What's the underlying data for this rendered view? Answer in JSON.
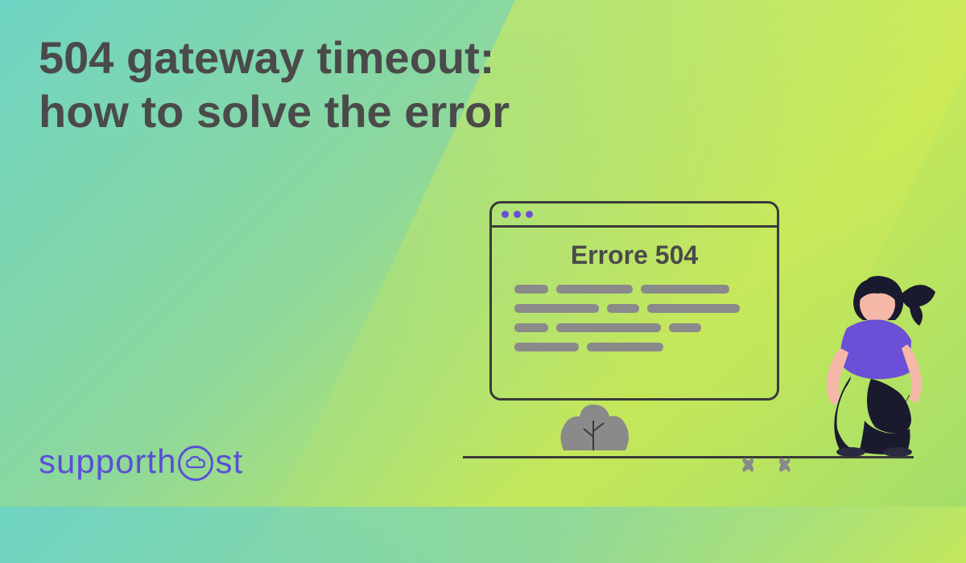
{
  "title_line1": "504 gateway timeout:",
  "title_line2": "how to solve the error",
  "logo": {
    "part1": "supporth",
    "part2": "st"
  },
  "browser": {
    "title": "Errore 504"
  },
  "colors": {
    "text_dark": "#4a4a4a",
    "brand_purple": "#5a4fd6",
    "line_gray": "#8a8a8a",
    "outline": "#3a3a3a"
  }
}
